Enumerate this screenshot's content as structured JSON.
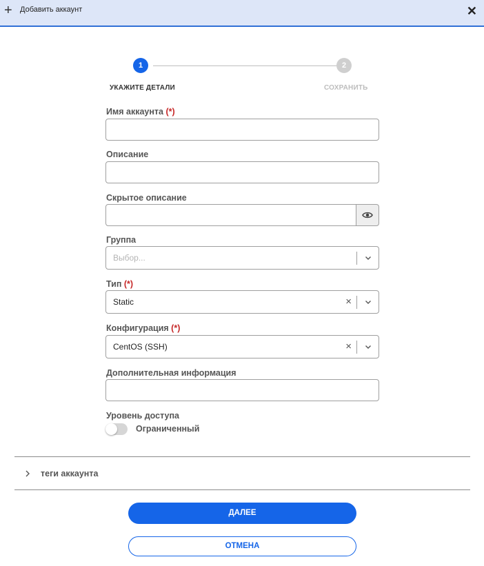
{
  "header": {
    "title": "Добавить аккаунт",
    "icons": {
      "add": "plus-icon",
      "close": "close-icon"
    }
  },
  "stepper": {
    "active_color": "#1565e8",
    "inactive_color": "#cfcfcf",
    "steps": [
      {
        "number": "1",
        "label": "УКАЖИТЕ ДЕТАЛИ",
        "state": "active"
      },
      {
        "number": "2",
        "label": "СОХРАНИТЬ",
        "state": "inactive"
      }
    ]
  },
  "form": {
    "required_marker": "(*)",
    "account_name": {
      "label": "Имя аккаунта",
      "value": ""
    },
    "description": {
      "label": "Описание",
      "value": ""
    },
    "hidden_description": {
      "label": "Скрытое описание",
      "value": "",
      "toggle_icon": "eye-icon"
    },
    "group": {
      "label": "Группа",
      "placeholder": "Выбор..."
    },
    "type": {
      "label": "Тип",
      "value": "Static"
    },
    "configuration": {
      "label": "Конфигурация",
      "value": "CentOS (SSH)"
    },
    "additional_info": {
      "label": "Дополнительная информация",
      "value": ""
    },
    "access_level": {
      "label": "Уровень доступа",
      "toggle_label": "Ограниченный",
      "enabled": false
    }
  },
  "tags_section": {
    "label": "теги аккаунта",
    "expanded": false
  },
  "actions": {
    "next": "ДАЛЕЕ",
    "cancel": "ОТМЕНА"
  },
  "colors": {
    "accent": "#1565e8",
    "header_bg": "#dde6f8",
    "required": "#c62828"
  }
}
